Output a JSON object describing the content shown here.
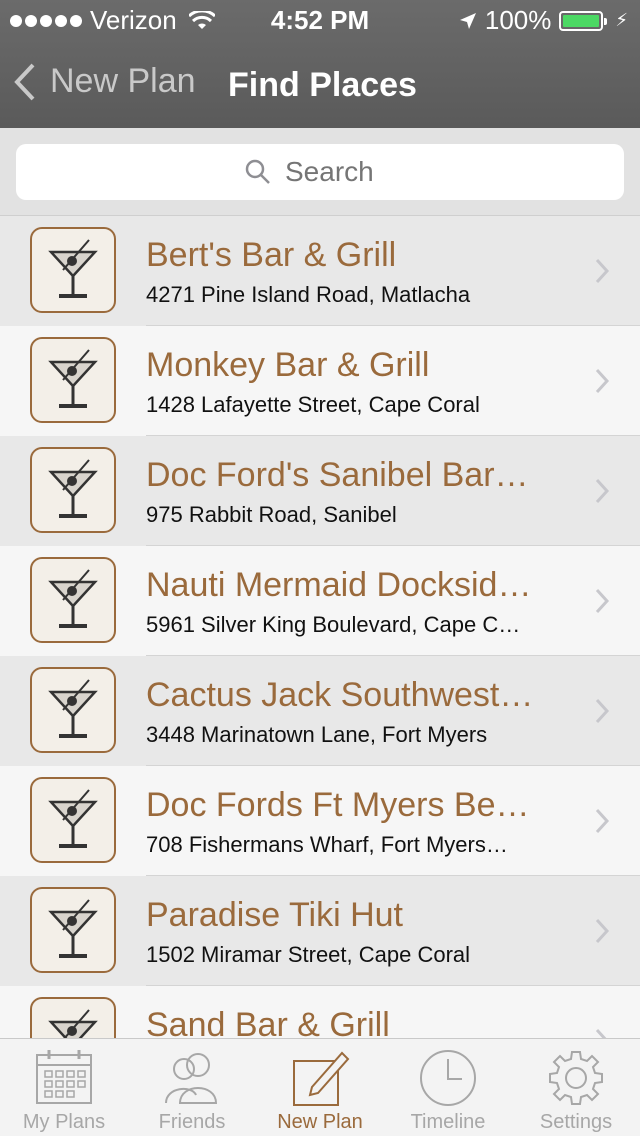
{
  "status_bar": {
    "carrier": "Verizon",
    "time": "4:52 PM",
    "battery": "100%"
  },
  "nav": {
    "back_label": "New Plan",
    "title": "Find Places"
  },
  "search": {
    "placeholder": "Search"
  },
  "places": [
    {
      "name": "Bert's Bar & Grill",
      "address": "4271 Pine Island Road, Matlacha"
    },
    {
      "name": "Monkey Bar & Grill",
      "address": "1428 Lafayette Street, Cape Coral"
    },
    {
      "name": "Doc Ford's Sanibel Bar…",
      "address": "975 Rabbit Road, Sanibel"
    },
    {
      "name": "Nauti Mermaid Docksid…",
      "address": "5961 Silver King Boulevard, Cape C…"
    },
    {
      "name": "Cactus Jack Southwest…",
      "address": "3448 Marinatown Lane, Fort Myers"
    },
    {
      "name": "Doc Fords Ft Myers Be…",
      "address": "708 Fishermans Wharf, Fort Myers…"
    },
    {
      "name": "Paradise Tiki Hut",
      "address": "1502 Miramar Street, Cape Coral"
    },
    {
      "name": "Sand Bar & Grill",
      "address": ""
    }
  ],
  "place_icon": "cocktail-glass-icon",
  "tabs": [
    {
      "label": "My Plans",
      "icon": "calendar-icon",
      "active": false
    },
    {
      "label": "Friends",
      "icon": "people-icon",
      "active": false
    },
    {
      "label": "New Plan",
      "icon": "compose-icon",
      "active": true
    },
    {
      "label": "Timeline",
      "icon": "clock-icon",
      "active": false
    },
    {
      "label": "Settings",
      "icon": "gear-icon",
      "active": false
    }
  ],
  "colors": {
    "accent": "#9a6a3c",
    "header": "#636363",
    "battery": "#4cd964"
  }
}
